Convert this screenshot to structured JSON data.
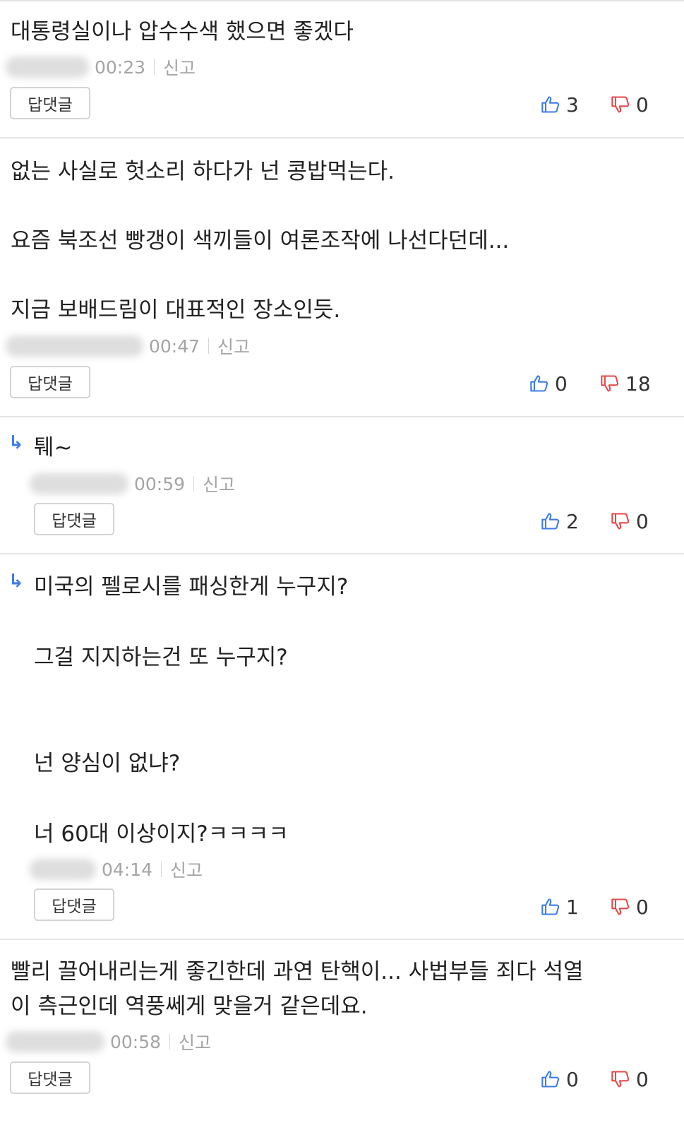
{
  "comments": [
    {
      "text": "대통령실이나 압수수색 했으면 좋겠다",
      "time": "00:23",
      "report_label": "신고",
      "reply_label": "답댓글",
      "likes": "3",
      "dislikes": "0",
      "is_reply": false
    },
    {
      "text": "없는 사실로 헛소리 하다가 넌 콩밥먹는다.\n\n요즘 북조선 빵갱이 색끼들이 여론조작에 나선다던데...\n\n지금 보배드림이 대표적인 장소인듯.",
      "time": "00:47",
      "report_label": "신고",
      "reply_label": "답댓글",
      "likes": "0",
      "dislikes": "18",
      "is_reply": false
    },
    {
      "text": "퉤~",
      "time": "00:59",
      "report_label": "신고",
      "reply_label": "답댓글",
      "likes": "2",
      "dislikes": "0",
      "is_reply": true
    },
    {
      "text": "미국의 펠로시를 패싱한게 누구지?\n\n그걸 지지하는건 또 누구지?\n\n\n넌 양심이 없냐?\n\n너 60대 이상이지?ㅋㅋㅋㅋ",
      "time": "04:14",
      "report_label": "신고",
      "reply_label": "답댓글",
      "likes": "1",
      "dislikes": "0",
      "is_reply": true
    },
    {
      "text": "빨리 끌어내리는게 좋긴한데 과연 탄핵이... 사법부들 죄다 석열\n이 측근인데 역풍쎄게 맞을거 같은데요.",
      "time": "00:58",
      "report_label": "신고",
      "reply_label": "답댓글",
      "likes": "0",
      "dislikes": "0",
      "is_reply": false
    }
  ],
  "reply_arrow": "↳",
  "icons": {
    "like": "thumbs-up-icon",
    "dislike": "thumbs-down-icon"
  },
  "colors": {
    "like": "#3f7de8",
    "dislike": "#e64a4a",
    "meta": "#a4a4a4",
    "divider": "#e4e4e4"
  }
}
